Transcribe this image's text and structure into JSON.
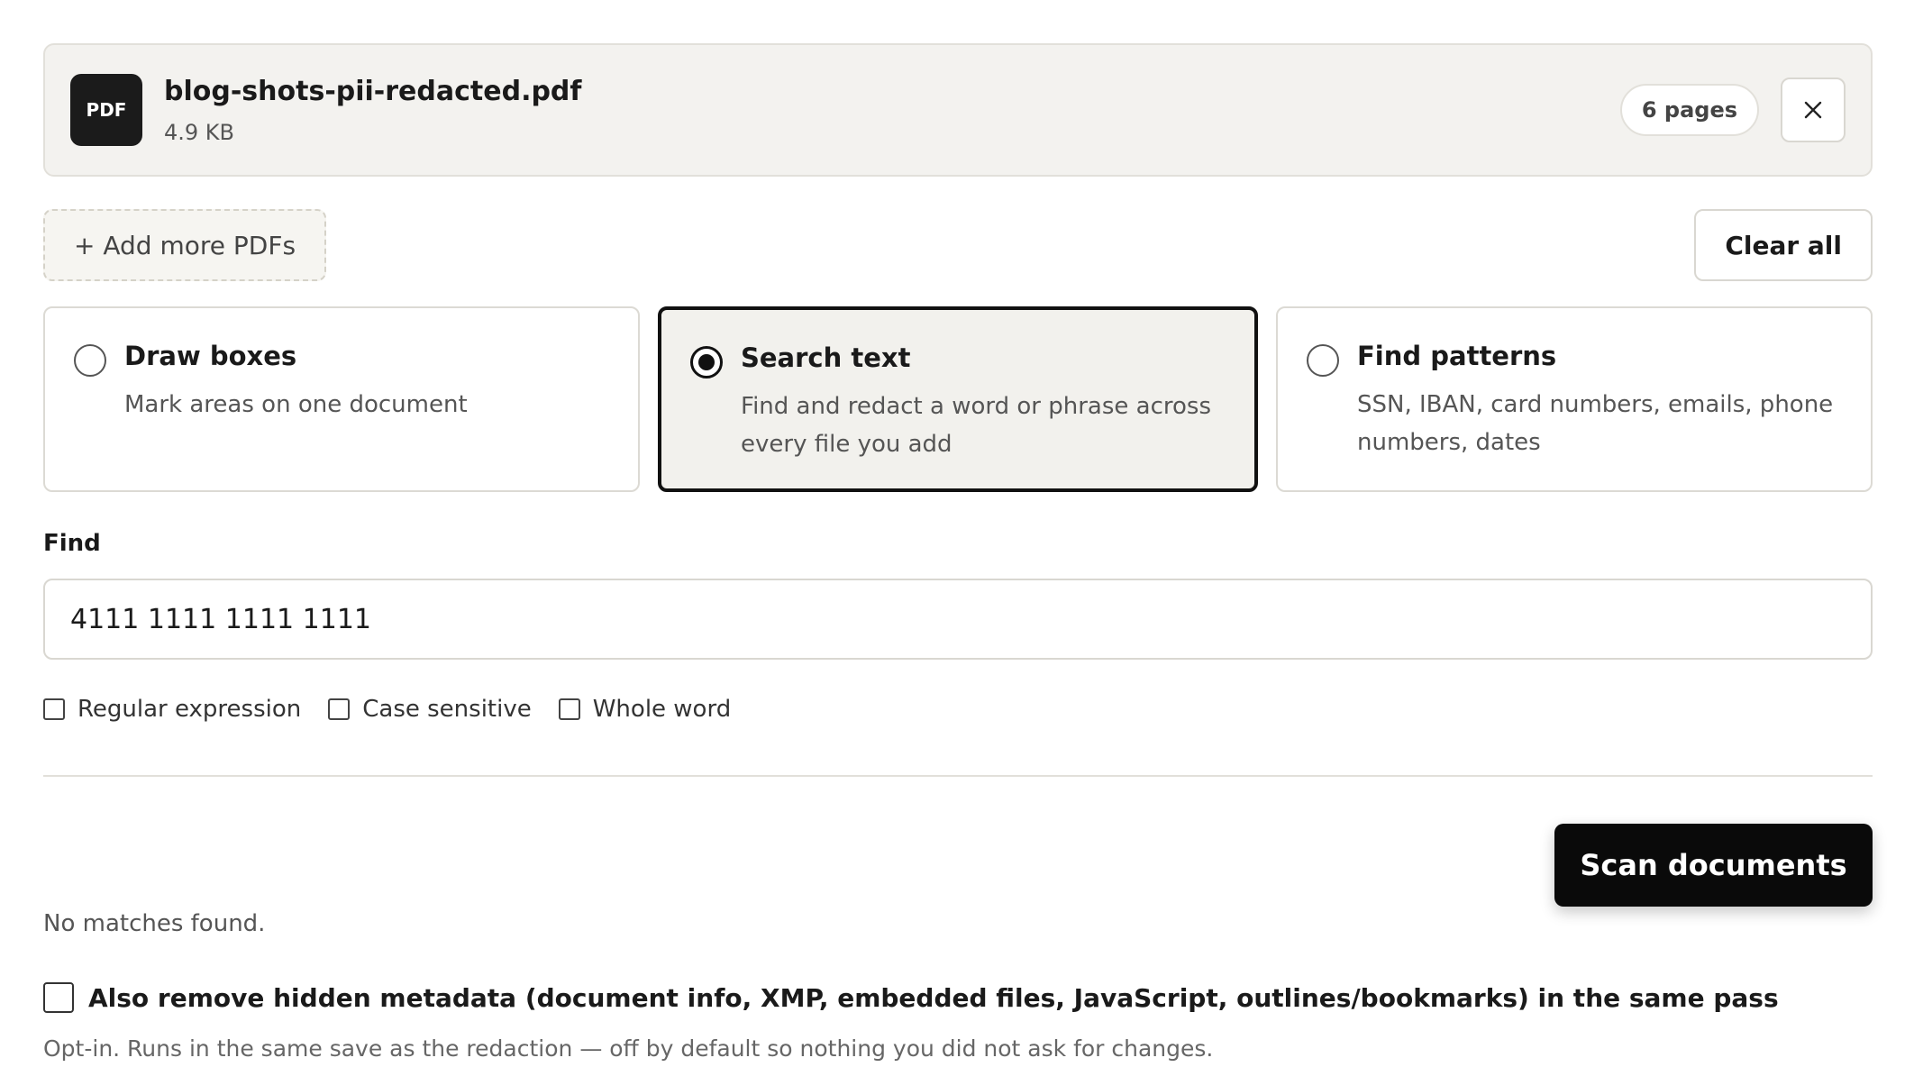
{
  "file": {
    "badge": "PDF",
    "name": "blog-shots-pii-redacted.pdf",
    "size": "4.9 KB",
    "pages": "6 pages"
  },
  "actions": {
    "add_more": "+ Add more PDFs",
    "clear_all": "Clear all"
  },
  "modes": [
    {
      "title": "Draw boxes",
      "desc": "Mark areas on one document",
      "selected": false
    },
    {
      "title": "Search text",
      "desc": "Find and redact a word or phrase across every file you add",
      "selected": true
    },
    {
      "title": "Find patterns",
      "desc": "SSN, IBAN, card numbers, emails, phone numbers, dates",
      "selected": false
    }
  ],
  "find": {
    "label": "Find",
    "value": "4111 1111 1111 1111"
  },
  "options": {
    "regex": "Regular expression",
    "case": "Case sensitive",
    "whole": "Whole word"
  },
  "scan": {
    "label": "Scan documents"
  },
  "status": "No matches found.",
  "metadata": {
    "label": "Also remove hidden metadata (document info, XMP, embedded files, JavaScript, outlines/bookmarks) in the same pass",
    "note": "Opt-in. Runs in the same save as the redaction — off by default so nothing you did not ask for changes."
  },
  "icons": {
    "close": "close-icon",
    "radio": "radio-icon",
    "checkbox": "checkbox-icon"
  },
  "colors": {
    "accent": "#0a0a0a",
    "card_bg": "#f3f2ef",
    "border": "#d9d7d1"
  }
}
